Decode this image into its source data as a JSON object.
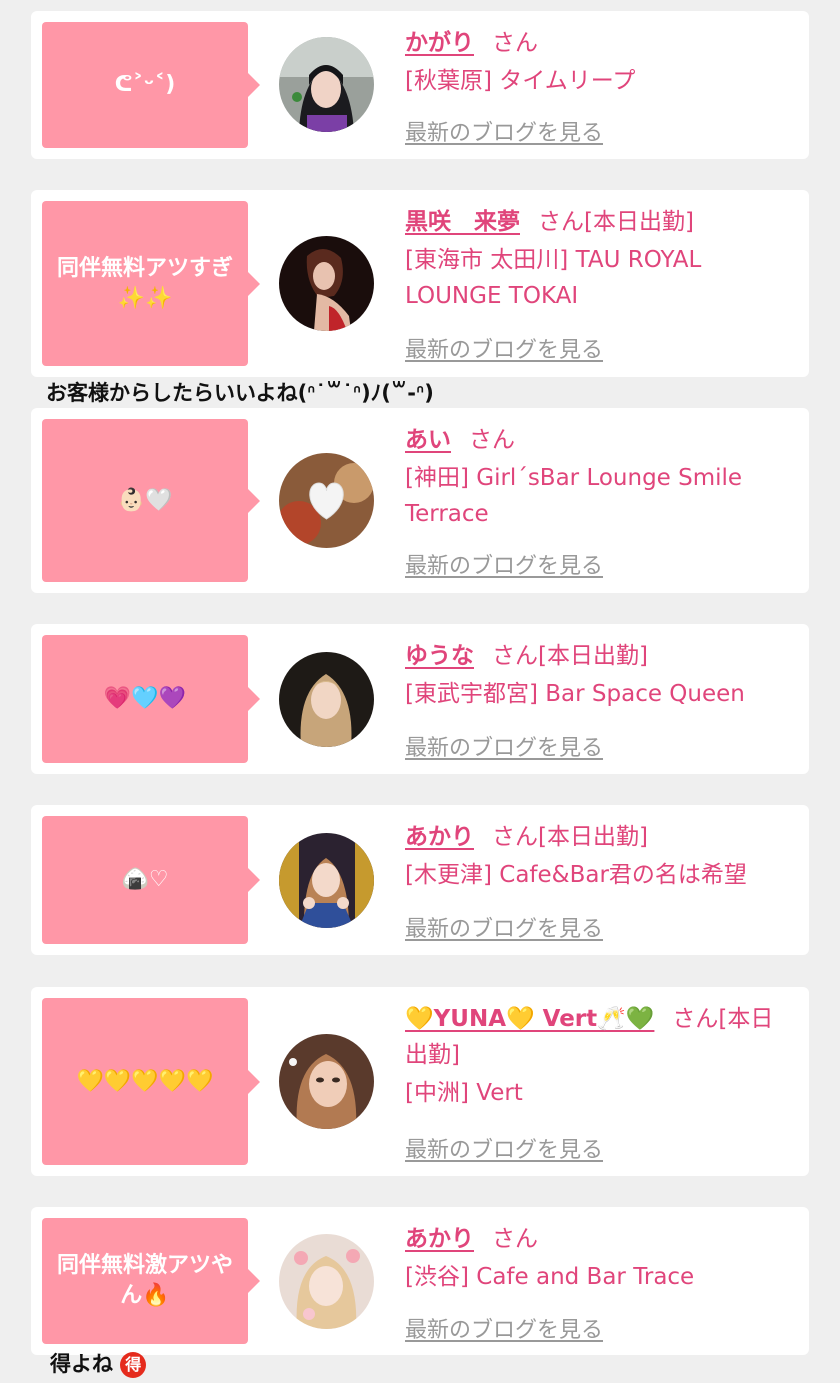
{
  "posts": [
    {
      "bubble": "ᕦ˃ᵕ˂)",
      "name": "かがり",
      "san": "さん",
      "status": "",
      "shop": "[秋葉原] タイムリープ",
      "blog_link": "最新のブログを見る"
    },
    {
      "bubble": "同伴無料アツすぎ✨✨",
      "name": "黒咲　来夢",
      "san": "さん",
      "status": "[本日出勤]",
      "shop": "[東海市 太田川] TAU ROYAL LOUNGE TOKAI",
      "blog_link": "最新のブログを見る",
      "caption": "お客様からしたらいいよね(ᐢ˙꒳˙ᐢ)ﾉ(꒳-ᐢ)"
    },
    {
      "bubble": "👶🏻🤍",
      "name": "あい",
      "san": "さん",
      "status": "",
      "shop": "[神田] Girl´sBar Lounge Smile Terrace",
      "blog_link": "最新のブログを見る"
    },
    {
      "bubble": "💗🩵💜",
      "name": "ゆうな",
      "san": "さん",
      "status": "[本日出勤]",
      "shop": "[東武宇都宮] Bar Space Queen",
      "blog_link": "最新のブログを見る"
    },
    {
      "bubble": "🍙♡",
      "name": "あかり",
      "san": "さん",
      "status": "[本日出勤]",
      "shop": "[木更津] Cafe&Bar君の名は希望",
      "blog_link": "最新のブログを見る"
    },
    {
      "bubble": "💛💛💛💛💛",
      "name": "💛YUNA💛 Vert🥂💚",
      "san": "さん",
      "status": "[本日出勤]",
      "shop": "[中洲] Vert",
      "blog_link": "最新のブログを見る"
    },
    {
      "bubble": "同伴無料激アツやん🔥",
      "name": "あかり",
      "san": "さん",
      "status": "",
      "shop": "[渋谷] Cafe and Bar Trace",
      "blog_link": "最新のブログを見る",
      "caption": "得よね",
      "caption_badge": "得"
    }
  ],
  "colors": {
    "accent": "#e0457b",
    "bubble": "#ff97a7",
    "link_gray": "#999999",
    "background": "#efefef"
  }
}
